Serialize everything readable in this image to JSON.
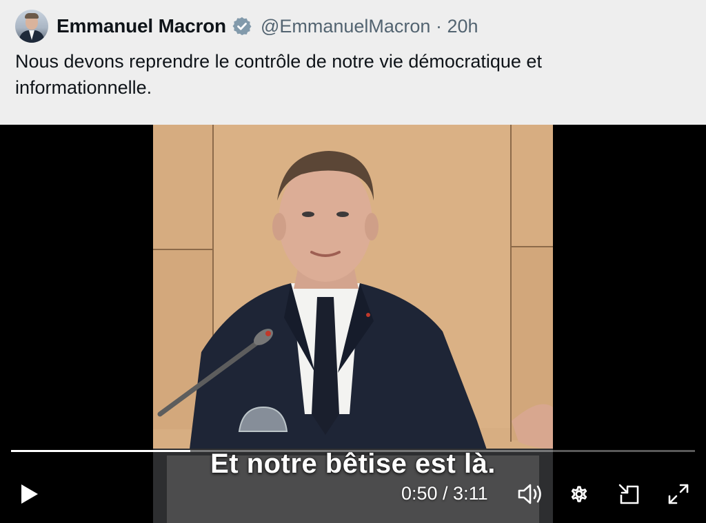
{
  "tweet": {
    "author_name": "Emmanuel Macron",
    "handle": "@EmmanuelMacron",
    "separator": "·",
    "time_ago": "20h",
    "text": "Nous devons reprendre le contrôle de notre vie démocratique et informationnelle.",
    "verified": true,
    "verified_color": "#829aab"
  },
  "video": {
    "caption": "Et notre bêtise est là.",
    "time_display": "0:50 / 3:11",
    "progress_fraction": 0.262,
    "icons": {
      "play": "play-icon",
      "volume": "volume-icon",
      "settings": "gear-icon",
      "picture_in_picture": "pip-icon",
      "fullscreen": "fullscreen-icon"
    }
  }
}
